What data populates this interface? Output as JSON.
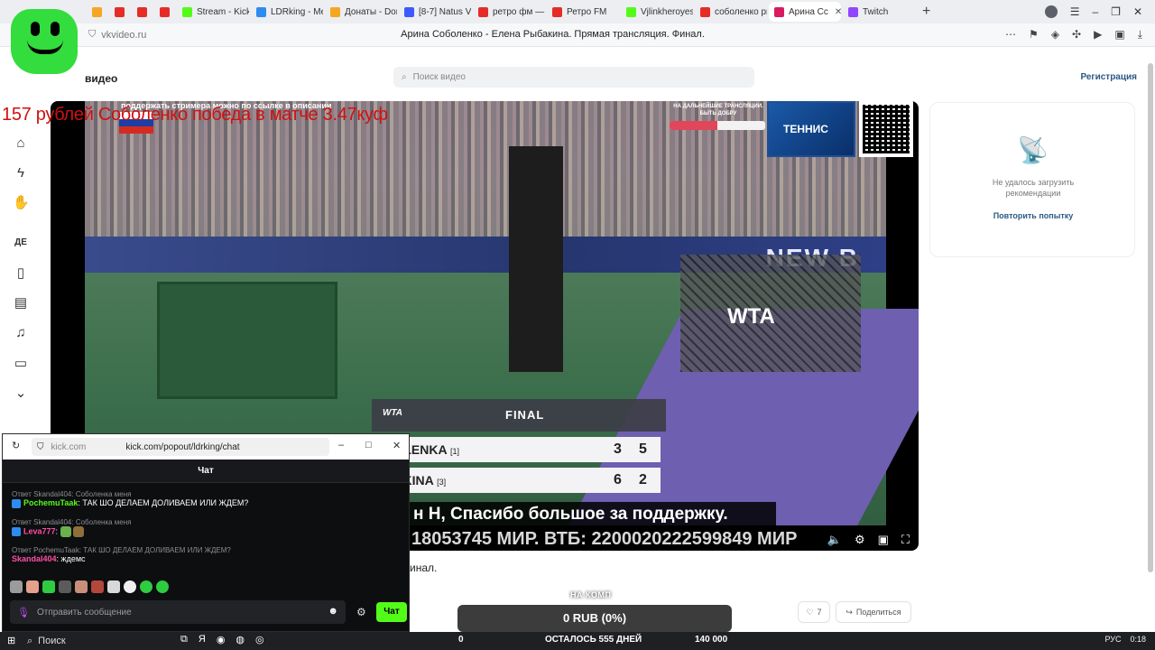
{
  "browser": {
    "tabs": [
      {
        "label": "",
        "color": "#f5a623"
      },
      {
        "label": "",
        "color": "#e52d27"
      },
      {
        "label": "",
        "color": "#e52d27"
      },
      {
        "label": "",
        "color": "#e52d27"
      },
      {
        "label": "Stream - Kick D",
        "color": "#53fc18"
      },
      {
        "label": "LDRking - Medi",
        "color": "#2d8cf0"
      },
      {
        "label": "Донаты - Dona",
        "color": "#f5a623"
      },
      {
        "label": "[8-7] Natus Vin",
        "color": "#3d5afe"
      },
      {
        "label": "ретро фм — Я",
        "color": "#e52d27"
      },
      {
        "label": "Ретро FM",
        "color": "#e52d27"
      },
      {
        "label": "Vjlinkheroyes S",
        "color": "#53fc18"
      },
      {
        "label": "соболенко ры",
        "color": "#e52d27"
      },
      {
        "label": "Арина Сс",
        "color": "#d81b60"
      },
      {
        "label": "Twitch",
        "color": "#9146ff"
      }
    ],
    "active_tab_index": 12,
    "url": "vkvideo.ru",
    "page_title": "Арина Соболенко - Елена Рыбакина. Прямая трансляция. Финал."
  },
  "vk": {
    "brand": "видео",
    "search_placeholder": "Поиск видео",
    "register": "Регистрация",
    "sidebar_icons": [
      "home-icon",
      "lightning-icon",
      "hand-icon",
      "kids-icon",
      "book-icon",
      "film-icon",
      "music-icon",
      "tv-icon",
      "chevron-down-icon"
    ]
  },
  "overlay_text": "157 рублей Соболенко победа в матче 3.47куф",
  "video": {
    "top_caption": "поддержать стримера можно по ссылке в описании",
    "promo_label": "НА ДАЛЬНЕЙШИЕ ТРАНСЛЯЦИИ. БЫТЬ ДОБРУ",
    "promo_progress": 0.5,
    "tennis_logo": "ТЕННИС",
    "wall_text": "NEW B",
    "court_logo": "WTA",
    "scoreboard": {
      "brand": "WTA",
      "title": "FINAL",
      "players": [
        {
          "name": "ABALENKA",
          "seed": "[1]",
          "set1": "3",
          "set2": "5"
        },
        {
          "name": "YBAKINA",
          "seed": "[3]",
          "set1": "6",
          "set2": "2"
        }
      ]
    },
    "ticker_line1": "н Н, Спасибо большое за поддержку.",
    "ticker_line2": "18053745 МИР. ВТБ: 2200020222599849 МИР"
  },
  "description_snippet": "инал.",
  "recommendations": {
    "error": "Не удалось загрузить рекомендации",
    "retry": "Повторить попытку"
  },
  "donation": {
    "label": "НА КОМП",
    "amount": "0 RUB (0%)",
    "collected": "0",
    "remaining": "ОСТАЛОСЬ 555 ДНЕЙ",
    "goal": "140 000"
  },
  "actions": {
    "likes": "7",
    "share": "Поделиться"
  },
  "popup": {
    "host": "kick.com",
    "path": "kick.com/popout/ldrking/chat",
    "chat_title": "Чат",
    "messages": [
      {
        "reply": "Ответ Skandal404: Соболенка меня",
        "user": "PochemuTaak",
        "user_color": "#53fc18",
        "text": "ТАК ШО ДЕЛАЕМ ДОЛИВАЕМ ИЛИ ЖДЕМ?"
      },
      {
        "reply": "Ответ Skandal404: Соболенка меня",
        "user": "Leva777",
        "user_color": "#ff4fa3",
        "text": ""
      },
      {
        "reply": "Ответ PochemuTaak: ТАК ШО ДЕЛАЕМ ДОЛИВАЕМ ИЛИ ЖДЕМ?",
        "user": "Skandal404",
        "user_color": "#ff4fa3",
        "text": "ждемс"
      }
    ],
    "input_placeholder": "Отправить сообщение",
    "send_label": "Чат"
  },
  "taskbar": {
    "search": "Поиск",
    "lang": "РУС",
    "time": "0:18"
  }
}
